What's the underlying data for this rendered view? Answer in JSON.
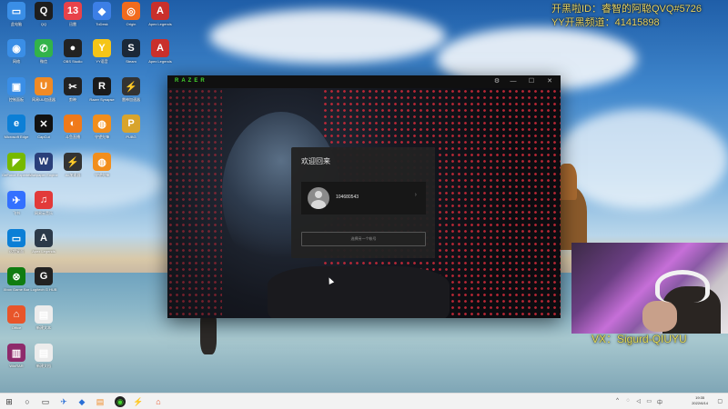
{
  "desktop_icons": [
    {
      "label": "此电脑",
      "color": "#3a8ee6",
      "glyph": "▭"
    },
    {
      "label": "QQ",
      "color": "#1e1e1e",
      "glyph": "Q"
    },
    {
      "label": "迅雷",
      "color": "#e8424a",
      "glyph": "13"
    },
    {
      "label": "ToDesk",
      "color": "#3c7fe6",
      "glyph": "◆"
    },
    {
      "label": "Origin",
      "color": "#f26b1d",
      "glyph": "◎"
    },
    {
      "label": "Apex Legends",
      "color": "#c9302c",
      "glyph": "A"
    },
    {
      "label": "网络",
      "color": "#3a8ee6",
      "glyph": "◉"
    },
    {
      "label": "微信",
      "color": "#32b34a",
      "glyph": "✆"
    },
    {
      "label": "OBS Studio",
      "color": "#222",
      "glyph": "●"
    },
    {
      "label": "YY语音",
      "color": "#f5c518",
      "glyph": "Y"
    },
    {
      "label": "Steam",
      "color": "#1b2838",
      "glyph": "S"
    },
    {
      "label": "Apex Legends",
      "color": "#c9302c",
      "glyph": "A"
    },
    {
      "label": "控制面板",
      "color": "#3a8ee6",
      "glyph": "▣"
    },
    {
      "label": "网易UU加速器",
      "color": "#f08a24",
      "glyph": "U"
    },
    {
      "label": "剪映",
      "color": "#222",
      "glyph": "✂"
    },
    {
      "label": "Razer Synapse",
      "color": "#1a1a1a",
      "glyph": "R"
    },
    {
      "label": "雷神加速器",
      "color": "#333",
      "glyph": "⚡"
    },
    {
      "label": "Microsoft Edge",
      "color": "#0c7fd6",
      "glyph": "e"
    },
    {
      "label": "CapCut",
      "color": "#111",
      "glyph": "✕"
    },
    {
      "label": "斗鱼直播",
      "color": "#f07a1a",
      "glyph": "◐"
    },
    {
      "label": "守望先锋",
      "color": "#f28e1c",
      "glyph": "◍"
    },
    {
      "label": "PUBG",
      "color": "#d8a42c",
      "glyph": "P"
    },
    {
      "label": "GeForce Experience",
      "color": "#76b900",
      "glyph": "◤"
    },
    {
      "label": "Wallpaper Engine",
      "color": "#2a3f7a",
      "glyph": "W"
    },
    {
      "label": "Ac加速器",
      "color": "#333",
      "glyph": "⚡"
    },
    {
      "label": "守望先锋",
      "color": "#f28e1c",
      "glyph": "◍"
    },
    {
      "label": "飞书",
      "color": "#3370ff",
      "glyph": "✈"
    },
    {
      "label": "网易云音乐",
      "color": "#e23a3a",
      "glyph": "♫"
    },
    {
      "label": "远程桌面",
      "color": "#0c7fd6",
      "glyph": "▭"
    },
    {
      "label": "Apex Legends",
      "color": "#2c3a4a",
      "glyph": "A"
    },
    {
      "label": "Xbox Game Bar",
      "color": "#107c10",
      "glyph": "⊗"
    },
    {
      "label": "Logitech G HUB",
      "color": "#222",
      "glyph": "G"
    },
    {
      "label": "Office",
      "color": "#e8552a",
      "glyph": "⌂"
    },
    {
      "label": "新建文本",
      "color": "#ececec",
      "glyph": "▤"
    },
    {
      "label": "WinRAR",
      "color": "#8e2a6b",
      "glyph": "▥"
    },
    {
      "label": "新建文档",
      "color": "#ececec",
      "glyph": "▤"
    }
  ],
  "overlay": {
    "line1": "开黑啦ID：睿智的阿聪QVQ#5726",
    "line2": "YY开黑频道：41415898",
    "vx": "VX：Sigurd-QIUYU",
    "badge_text": "1"
  },
  "razer_app": {
    "brand": "RAZER",
    "titlebar_icons": {
      "settings": "gear-icon",
      "minimize": "minimize-icon",
      "maximize": "maximize-icon",
      "close": "close-icon"
    },
    "welcome": "欢迎回来",
    "account_id": "104680543",
    "other_account": "选择另一个帐号"
  },
  "taskbar": {
    "time": "19:35",
    "date": "2022/6/14",
    "colors": {
      "accent": "#44d62c",
      "razer_green": "#44d62c"
    }
  }
}
